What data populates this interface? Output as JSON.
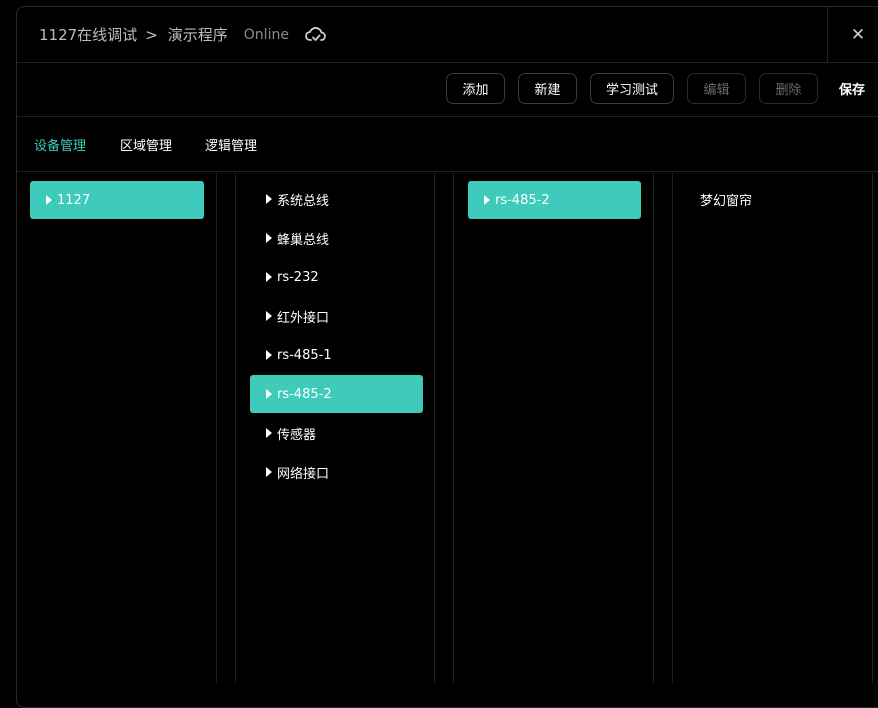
{
  "header": {
    "project": "1127在线调试",
    "separator": ">",
    "program": "演示程序",
    "status": "Online",
    "cloud_icon": "cloud-sync-icon",
    "close_icon": "close-icon",
    "close_glyph": "✕"
  },
  "toolbar": {
    "add": "添加",
    "new": "新建",
    "learn_test": "学习测试",
    "edit": "编辑",
    "delete": "删除",
    "save": "保存"
  },
  "tabs": [
    {
      "label": "设备管理",
      "active": true
    },
    {
      "label": "区域管理",
      "active": false
    },
    {
      "label": "逻辑管理",
      "active": false
    }
  ],
  "columns": {
    "hosts": [
      {
        "label": "1127",
        "selected": true
      }
    ],
    "interfaces": [
      {
        "label": "系统总线",
        "selected": false
      },
      {
        "label": "蜂巢总线",
        "selected": false
      },
      {
        "label": "rs-232",
        "selected": false
      },
      {
        "label": "红外接口",
        "selected": false
      },
      {
        "label": "rs-485-1",
        "selected": false
      },
      {
        "label": "rs-485-2",
        "selected": true
      },
      {
        "label": "传感器",
        "selected": false
      },
      {
        "label": "网络接口",
        "selected": false
      }
    ],
    "ports": [
      {
        "label": "rs-485-2",
        "selected": true
      }
    ],
    "devices": [
      {
        "label": "梦幻窗帘"
      }
    ]
  },
  "colors": {
    "accent": "#3ecbbb",
    "background": "#000000",
    "divider": "#222222"
  }
}
